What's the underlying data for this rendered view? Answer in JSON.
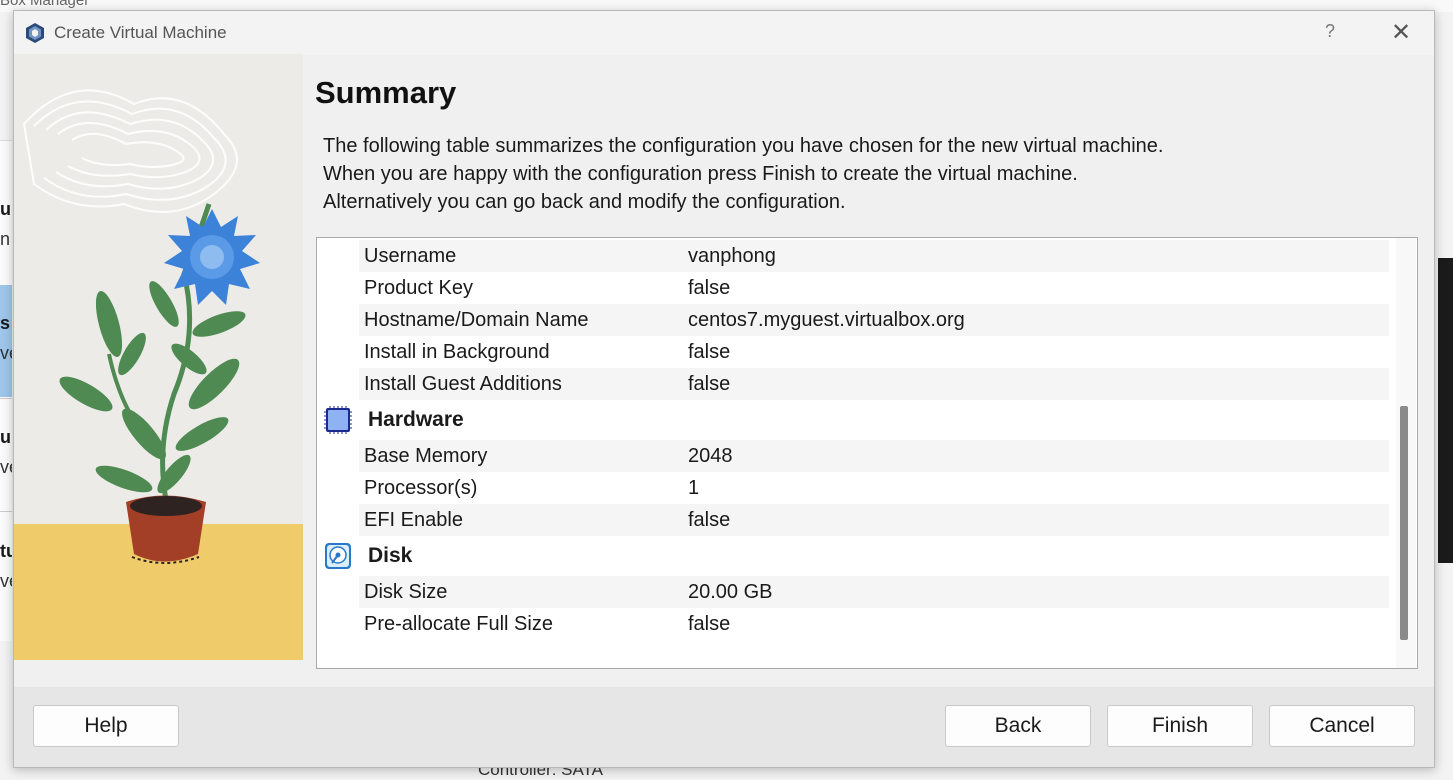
{
  "background": {
    "window_title": "Box Manager",
    "sidebar_fragments": [
      {
        "bold": "u",
        "sub": "n"
      },
      {
        "bold": "s",
        "sub": "ve"
      },
      {
        "bold": "u",
        "sub": "ve"
      },
      {
        "bold": "tu",
        "sub": "ve"
      }
    ],
    "bottom_text": "Controller: SATA"
  },
  "dialog": {
    "title": "Create Virtual Machine",
    "help_glyph": "?",
    "close_glyph": "✕",
    "heading": "Summary",
    "description": [
      "The following table summarizes the configuration you have chosen for the new virtual machine.",
      "When you are happy with the configuration press Finish to create the virtual machine.",
      "Alternatively you can go back and modify the configuration."
    ],
    "table": {
      "unattended_rows": [
        {
          "key": "Username",
          "value": "vanphong"
        },
        {
          "key": "Product Key",
          "value": "false"
        },
        {
          "key": "Hostname/Domain Name",
          "value": "centos7.myguest.virtualbox.org"
        },
        {
          "key": "Install in Background",
          "value": "false"
        },
        {
          "key": "Install Guest Additions",
          "value": "false"
        }
      ],
      "hardware": {
        "label": "Hardware",
        "icon": "chip-icon",
        "rows": [
          {
            "key": "Base Memory",
            "value": "2048"
          },
          {
            "key": "Processor(s)",
            "value": "1"
          },
          {
            "key": "EFI Enable",
            "value": "false"
          }
        ]
      },
      "disk": {
        "label": "Disk",
        "icon": "hard-disk-icon",
        "rows": [
          {
            "key": "Disk Size",
            "value": "20.00 GB"
          },
          {
            "key": "Pre-allocate Full Size",
            "value": "false"
          }
        ]
      }
    },
    "buttons": {
      "help": "Help",
      "back": "Back",
      "finish": "Finish",
      "cancel": "Cancel"
    }
  },
  "colors": {
    "accent_blue": "#3b82d8",
    "leaf_green": "#4e8a52",
    "pot_red": "#a23f26",
    "sand_yellow": "#f0cb6a"
  }
}
